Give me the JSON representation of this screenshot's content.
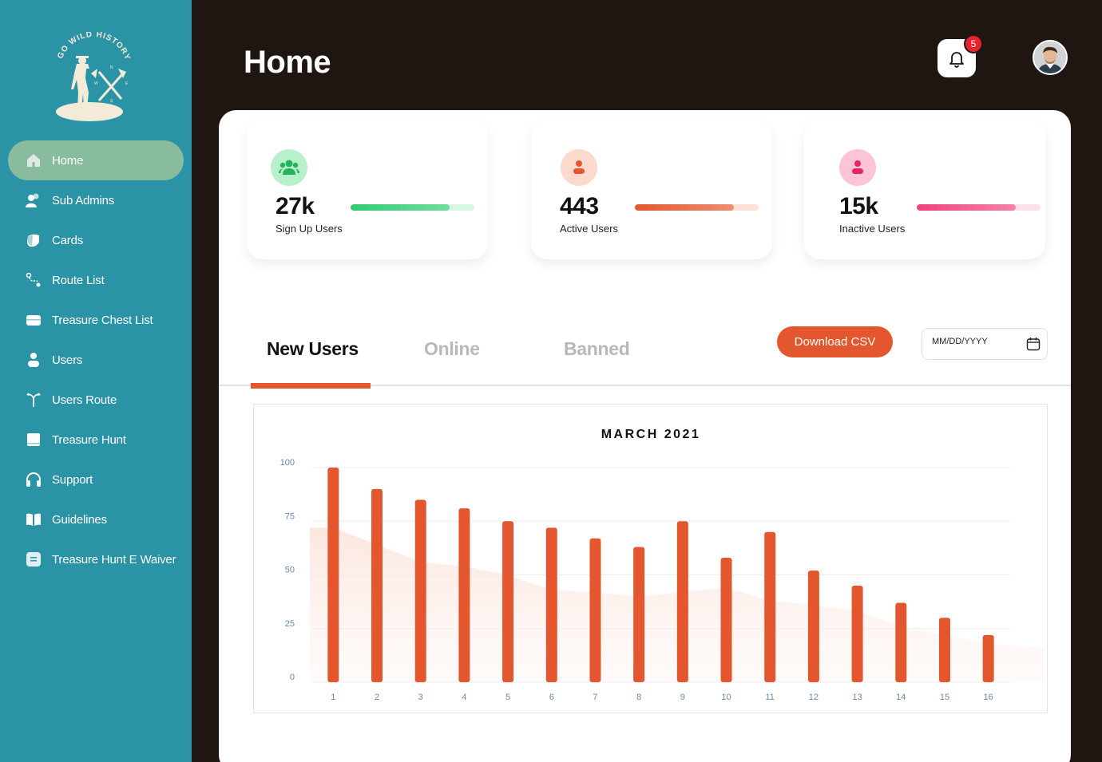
{
  "sidebar": {
    "logo_text": "GO WILD HISTORY",
    "items": [
      {
        "label": "Home",
        "icon": "home-icon",
        "active": true
      },
      {
        "label": "Sub Admins",
        "icon": "users-group-icon",
        "active": false
      },
      {
        "label": "Cards",
        "icon": "card-icon",
        "active": false
      },
      {
        "label": "Route List",
        "icon": "route-icon",
        "active": false
      },
      {
        "label": "Treasure Chest List",
        "icon": "chest-icon",
        "active": false
      },
      {
        "label": "Users",
        "icon": "user-icon",
        "active": false
      },
      {
        "label": "Users Route",
        "icon": "branch-route-icon",
        "active": false
      },
      {
        "label": "Treasure Hunt",
        "icon": "hunt-icon",
        "active": false
      },
      {
        "label": "Support",
        "icon": "headphones-icon",
        "active": false
      },
      {
        "label": "Guidelines",
        "icon": "book-icon",
        "active": false
      },
      {
        "label": "Treasure Hunt E Waiver",
        "icon": "document-icon",
        "active": false
      }
    ]
  },
  "header": {
    "title": "Home",
    "notification_count": "5"
  },
  "stats": [
    {
      "value": "27k",
      "label": "Sign Up Users",
      "level": 0.8,
      "color": "#2ecc71",
      "track": "#d8f7e3",
      "icon_bg": "#b8f0cc"
    },
    {
      "value": "443",
      "label": "Active Users",
      "level": 0.8,
      "color": "#e4572e",
      "track": "#fbe1d8",
      "icon_bg": "#fbd9cd"
    },
    {
      "value": "15k",
      "label": "Inactive Users",
      "level": 0.8,
      "color": "#f0437a",
      "track": "#fde1ea",
      "icon_bg": "#fcc4d6"
    }
  ],
  "tabs": [
    {
      "label": "New Users",
      "active": true
    },
    {
      "label": "Online",
      "active": false
    },
    {
      "label": "Banned",
      "active": false
    }
  ],
  "actions": {
    "download_label": "Download CSV",
    "date_placeholder": "MM/DD/YYYY"
  },
  "colors": {
    "sidebar": "#2a93a5",
    "accent": "#e4572e",
    "background": "#1f1612"
  },
  "chart_data": {
    "type": "bar",
    "title": "MARCH 2021",
    "categories": [
      "1",
      "2",
      "3",
      "4",
      "5",
      "6",
      "7",
      "8",
      "9",
      "10",
      "11",
      "12",
      "13",
      "14",
      "15",
      "16"
    ],
    "values": [
      100,
      90,
      85,
      81,
      75,
      72,
      67,
      63,
      75,
      58,
      70,
      52,
      45,
      37,
      30,
      22
    ],
    "area_values": [
      72,
      64,
      56,
      54,
      50,
      43,
      42,
      40,
      42,
      44,
      38,
      36,
      33,
      26,
      22,
      18
    ],
    "yticks": [
      0,
      25,
      50,
      75,
      100
    ],
    "ylim": [
      0,
      100
    ],
    "grid": true
  }
}
